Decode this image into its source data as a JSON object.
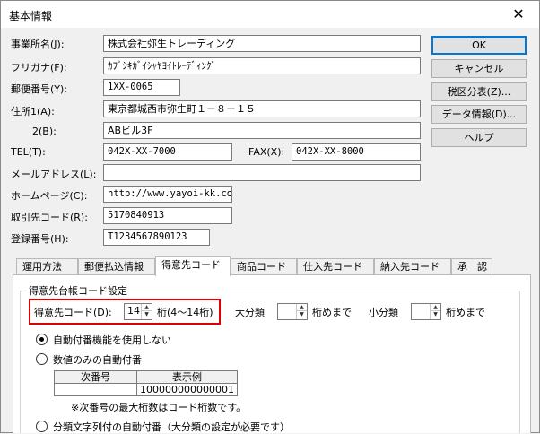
{
  "window": {
    "title": "基本情報",
    "close_glyph": "✕"
  },
  "form": {
    "company_label": "事業所名(J):",
    "company_value": "株式会社弥生トレーディング",
    "furigana_label": "フリガナ(F):",
    "furigana_value": "ｶﾌﾞｼｷｶﾞｲｼｬﾔﾖｲﾄﾚｰﾃﾞｨﾝｸﾞ",
    "postal_label": "郵便番号(Y):",
    "postal_value": "1XX-0065",
    "address1_label": "住所1(A):",
    "address1_value": "東京都城西市弥生町１－８－１５",
    "address2_label": "2(B):",
    "address2_value": "ABビル3F",
    "tel_label": "TEL(T):",
    "tel_value": "042X-XX-7000",
    "fax_label": "FAX(X):",
    "fax_value": "042X-XX-8000",
    "mail_label": "メールアドレス(L):",
    "mail_value": "",
    "homepage_label": "ホームページ(C):",
    "homepage_value": "http://www.yayoi-kk.co.jp/",
    "client_code_label": "取引先コード(R):",
    "client_code_value": "5170840913",
    "reg_no_label": "登録番号(H):",
    "reg_no_value": "T1234567890123"
  },
  "buttons": {
    "ok": "OK",
    "cancel": "キャンセル",
    "tax": "税区分表(Z)...",
    "data_info": "データ情報(D)...",
    "help": "ヘルプ"
  },
  "tabs": [
    "運用方法",
    "郵便払込情報",
    "得意先コード",
    "商品コード",
    "仕入先コード",
    "納入先コード",
    "承　認"
  ],
  "active_tab": 2,
  "panel": {
    "group_title": "得意先台帳コード設定",
    "code_label": "得意先コード(D):",
    "code_digits": "14",
    "digits_range": "桁(4～14桁)",
    "major_label": "大分類",
    "major_suffix": "桁めまで",
    "minor_label": "小分類",
    "minor_suffix": "桁めまで",
    "radio_none": "自動付番機能を使用しない",
    "radio_numeric": "数値のみの自動付番",
    "table_header_seq": "次番号",
    "table_header_example": "表示例",
    "table_example_value": "100000000000001",
    "note": "※次番号の最大桁数はコード桁数です。",
    "radio_classified": "分類文字列付の自動付番（大分類の設定が必要です）"
  }
}
